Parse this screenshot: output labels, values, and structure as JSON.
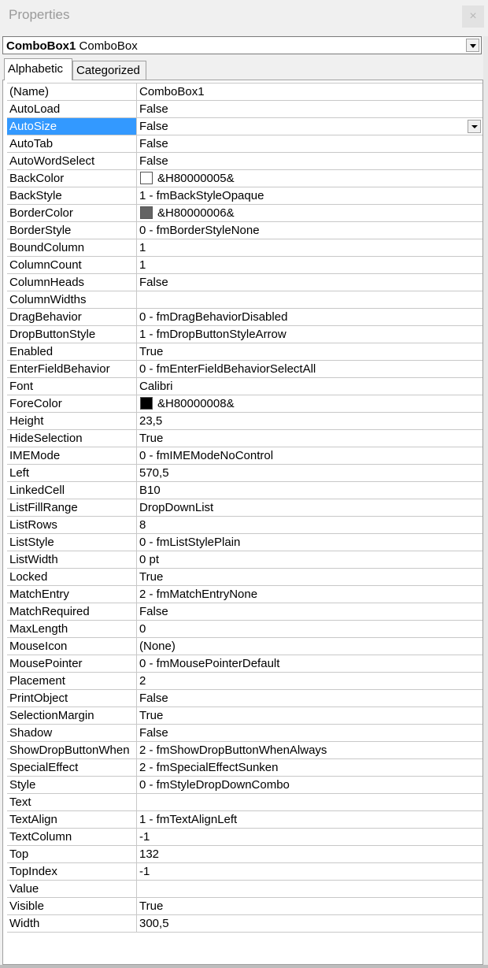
{
  "window": {
    "title": "Properties",
    "close_glyph": "×"
  },
  "object_selector": {
    "name": "ComboBox1",
    "type": "ComboBox"
  },
  "tabs": [
    {
      "label": "Alphabetic",
      "active": true
    },
    {
      "label": "Categorized",
      "active": false
    }
  ],
  "properties": [
    {
      "name": "(Name)",
      "value": "ComboBox1"
    },
    {
      "name": "AutoLoad",
      "value": "False"
    },
    {
      "name": "AutoSize",
      "value": "False",
      "selected": true
    },
    {
      "name": "AutoTab",
      "value": "False"
    },
    {
      "name": "AutoWordSelect",
      "value": "False"
    },
    {
      "name": "BackColor",
      "value": "&H80000005&",
      "swatch": "#ffffff"
    },
    {
      "name": "BackStyle",
      "value": "1 - fmBackStyleOpaque"
    },
    {
      "name": "BorderColor",
      "value": "&H80000006&",
      "swatch": "#646464"
    },
    {
      "name": "BorderStyle",
      "value": "0 - fmBorderStyleNone"
    },
    {
      "name": "BoundColumn",
      "value": "1"
    },
    {
      "name": "ColumnCount",
      "value": "1"
    },
    {
      "name": "ColumnHeads",
      "value": "False"
    },
    {
      "name": "ColumnWidths",
      "value": ""
    },
    {
      "name": "DragBehavior",
      "value": "0 - fmDragBehaviorDisabled"
    },
    {
      "name": "DropButtonStyle",
      "value": "1 - fmDropButtonStyleArrow"
    },
    {
      "name": "Enabled",
      "value": "True"
    },
    {
      "name": "EnterFieldBehavior",
      "value": "0 - fmEnterFieldBehaviorSelectAll"
    },
    {
      "name": "Font",
      "value": "Calibri"
    },
    {
      "name": "ForeColor",
      "value": "&H80000008&",
      "swatch": "#000000"
    },
    {
      "name": "Height",
      "value": "23,5"
    },
    {
      "name": "HideSelection",
      "value": "True"
    },
    {
      "name": "IMEMode",
      "value": "0 - fmIMEModeNoControl"
    },
    {
      "name": "Left",
      "value": "570,5"
    },
    {
      "name": "LinkedCell",
      "value": "B10"
    },
    {
      "name": "ListFillRange",
      "value": "DropDownList"
    },
    {
      "name": "ListRows",
      "value": "8"
    },
    {
      "name": "ListStyle",
      "value": "0 - fmListStylePlain"
    },
    {
      "name": "ListWidth",
      "value": "0 pt"
    },
    {
      "name": "Locked",
      "value": "True"
    },
    {
      "name": "MatchEntry",
      "value": "2 - fmMatchEntryNone"
    },
    {
      "name": "MatchRequired",
      "value": "False"
    },
    {
      "name": "MaxLength",
      "value": "0"
    },
    {
      "name": "MouseIcon",
      "value": "(None)"
    },
    {
      "name": "MousePointer",
      "value": "0 - fmMousePointerDefault"
    },
    {
      "name": "Placement",
      "value": "2"
    },
    {
      "name": "PrintObject",
      "value": "False"
    },
    {
      "name": "SelectionMargin",
      "value": "True"
    },
    {
      "name": "Shadow",
      "value": "False"
    },
    {
      "name": "ShowDropButtonWhen",
      "value": "2 - fmShowDropButtonWhenAlways"
    },
    {
      "name": "SpecialEffect",
      "value": "2 - fmSpecialEffectSunken"
    },
    {
      "name": "Style",
      "value": "0 - fmStyleDropDownCombo"
    },
    {
      "name": "Text",
      "value": ""
    },
    {
      "name": "TextAlign",
      "value": "1 - fmTextAlignLeft"
    },
    {
      "name": "TextColumn",
      "value": "-1"
    },
    {
      "name": "Top",
      "value": "132"
    },
    {
      "name": "TopIndex",
      "value": "-1"
    },
    {
      "name": "Value",
      "value": ""
    },
    {
      "name": "Visible",
      "value": "True"
    },
    {
      "name": "Width",
      "value": "300,5"
    }
  ],
  "colors": {
    "selection": "#3399ff",
    "grid_line": "#c8c8c8",
    "title_text": "#9a9a9a"
  }
}
